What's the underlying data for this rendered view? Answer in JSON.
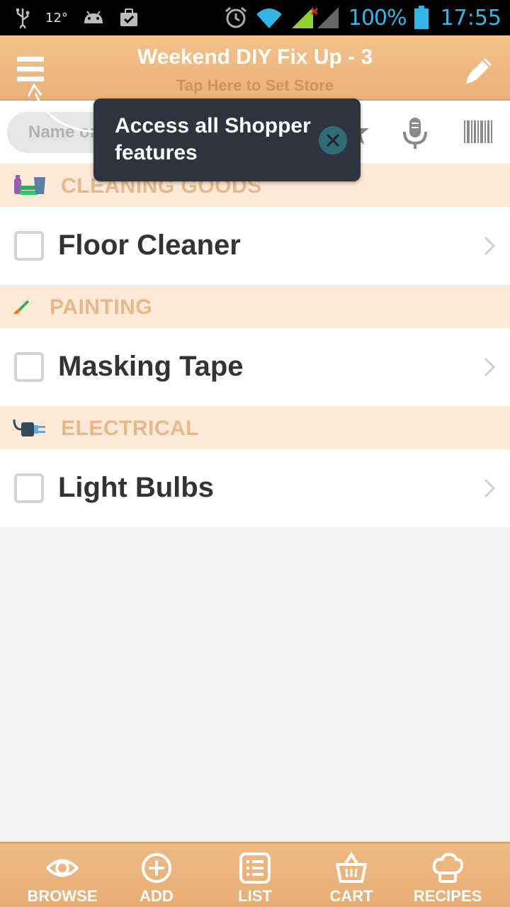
{
  "status_bar": {
    "temperature": "12°",
    "battery": "100%",
    "time": "17:55"
  },
  "header": {
    "title": "Weekend DIY Fix Up - 3",
    "subtitle": "Tap Here to Set Store",
    "menu_icon": "hamburger-menu-icon",
    "edit_icon": "pencil-icon"
  },
  "search": {
    "placeholder": "Name or",
    "icons": [
      "search-icon",
      "star-icon",
      "microphone-icon",
      "barcode-icon"
    ]
  },
  "tooltip": {
    "text": "Access all Shopper features",
    "close_icon": "close-icon"
  },
  "list": {
    "categories": [
      {
        "label": "CLEANING GOODS",
        "icon": "cleaning-supplies-icon",
        "items": [
          {
            "name": "Floor Cleaner",
            "checked": false
          }
        ]
      },
      {
        "label": "PAINTING",
        "icon": "paintbrush-icon",
        "items": [
          {
            "name": "Masking Tape",
            "checked": false
          }
        ]
      },
      {
        "label": "ELECTRICAL",
        "icon": "electrical-plug-icon",
        "items": [
          {
            "name": "Light Bulbs",
            "checked": false
          }
        ]
      }
    ]
  },
  "bottom_nav": [
    {
      "label": "BROWSE",
      "icon": "eye-icon"
    },
    {
      "label": "ADD",
      "icon": "add-circle-icon"
    },
    {
      "label": "LIST",
      "icon": "list-icon"
    },
    {
      "label": "CART",
      "icon": "basket-icon"
    },
    {
      "label": "RECIPES",
      "icon": "chef-hat-icon"
    }
  ],
  "colors": {
    "header": "#eeb57f",
    "category_bg": "#fde9d7",
    "category_text": "#e6b88a",
    "tooltip_bg": "#2f3340",
    "status_accent": "#33b5e5"
  }
}
